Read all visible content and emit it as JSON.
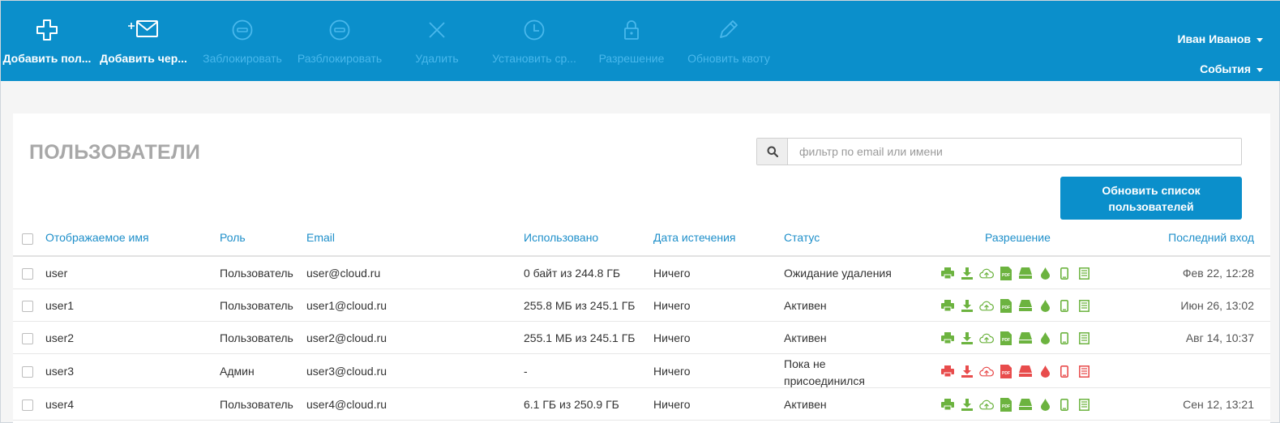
{
  "toolbar": {
    "buttons": [
      {
        "label": "Добавить пол...",
        "icon": "plus-icon",
        "enabled": true
      },
      {
        "label": "Добавить чер...",
        "icon": "mail-plus-icon",
        "enabled": true
      },
      {
        "label": "Заблокировать",
        "icon": "minus-circle-icon",
        "enabled": false
      },
      {
        "label": "Разблокировать",
        "icon": "minus-circle-icon",
        "enabled": false
      },
      {
        "label": "Удалить",
        "icon": "close-icon",
        "enabled": false
      },
      {
        "label": "Установить ср...",
        "icon": "clock-icon",
        "enabled": false
      },
      {
        "label": "Разрешение",
        "icon": "lock-icon",
        "enabled": false
      },
      {
        "label": "Обновить квоту",
        "icon": "pencil-icon",
        "enabled": false
      }
    ],
    "user_name": "Иван Иванов",
    "events_label": "События"
  },
  "page": {
    "title": "ПОЛЬЗОВАТЕЛИ",
    "search_placeholder": "фильтр по email или имени",
    "refresh_label": "Обновить список пользователей"
  },
  "table": {
    "headers": {
      "name": "Отображаемое имя",
      "role": "Роль",
      "email": "Email",
      "used": "Использовано",
      "expiry": "Дата истечения",
      "status": "Статус",
      "permission": "Разрешение",
      "last_login": "Последний вход"
    },
    "rows": [
      {
        "name": "user",
        "role": "Пользователь",
        "email": "user@cloud.ru",
        "used": "0 байт из 244.8 ГБ",
        "expiry": "Ничего",
        "status": "Ожидание удаления",
        "last_login": "Фев 22, 12:28",
        "perm_color": "green"
      },
      {
        "name": "user1",
        "role": "Пользователь",
        "email": "user1@cloud.ru",
        "used": "255.8 МБ из 245.1 ГБ",
        "expiry": "Ничего",
        "status": "Активен",
        "last_login": "Июн 26, 13:02",
        "perm_color": "green"
      },
      {
        "name": "user2",
        "role": "Пользователь",
        "email": "user2@cloud.ru",
        "used": "255.1 МБ из 245.1 ГБ",
        "expiry": "Ничего",
        "status": "Активен",
        "last_login": "Авг 14, 10:37",
        "perm_color": "green"
      },
      {
        "name": "user3",
        "role": "Админ",
        "email": "user3@cloud.ru",
        "used": "-",
        "expiry": "Ничего",
        "status": "Пока не присоединился",
        "last_login": "",
        "perm_color": "red"
      },
      {
        "name": "user4",
        "role": "Пользователь",
        "email": "user4@cloud.ru",
        "used": "6.1 ГБ из 250.9 ГБ",
        "expiry": "Ничего",
        "status": "Активен",
        "last_login": "Сен 12, 13:21",
        "perm_color": "green"
      }
    ],
    "permission_icons": [
      "print-icon",
      "download-icon",
      "cloud-upload-icon",
      "pdf-icon",
      "drive-icon",
      "drop-icon",
      "mobile-icon",
      "list-icon"
    ]
  },
  "colors": {
    "toolbar": "#0b8fcb",
    "accent": "#1e8fca",
    "perm_green": "#6cb33f",
    "perm_red": "#e84c4c",
    "pdf_green_bg": "#6cb33f"
  }
}
